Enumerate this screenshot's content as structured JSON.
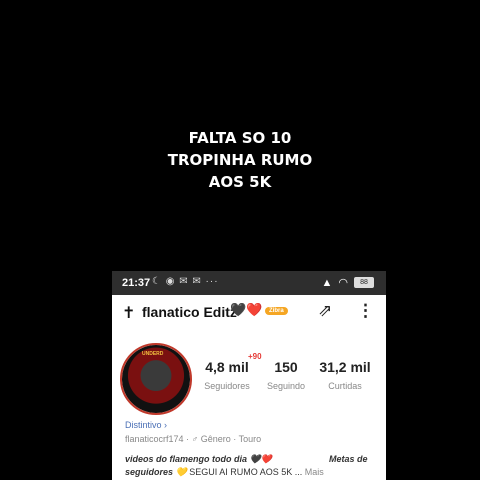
{
  "caption": {
    "line1": "FALTA SO 10",
    "line2": "TROPINHA RUMO",
    "line3": "AOS 5K"
  },
  "status_bar": {
    "time": "21:37",
    "icons": "☾ ◉ ✉ ✉ ···",
    "signal": "▲",
    "wifi": "◠",
    "battery": "88"
  },
  "profile": {
    "name": "flanatico Editz",
    "hearts": "🖤❤️",
    "badge": "Zibra",
    "avatar_text": "UNDERD",
    "stats": [
      {
        "value": "4,8 mil",
        "label": "Seguidores"
      },
      {
        "value": "150",
        "label": "Seguindo"
      },
      {
        "value": "31,2 mil",
        "label": "Curtidas"
      }
    ],
    "followers_delta": "+90",
    "distintivo": "Distintivo ›",
    "username_line": "flanaticocrf174  ·  ♂ Gênero  ·  Touro",
    "bio_line1_left": "videos do flamengo todo dia 🖤❤️",
    "bio_line1_right": "Metas de",
    "bio_line2_bold": "seguidores 💛",
    "bio_line2_text": " SEGUI AI RUMO AOS 5K ... ",
    "bio_more": "Mais"
  },
  "colors": {
    "accent_red": "#e53935",
    "badge_orange": "#f5a623",
    "link_blue": "#4a6fb5"
  }
}
